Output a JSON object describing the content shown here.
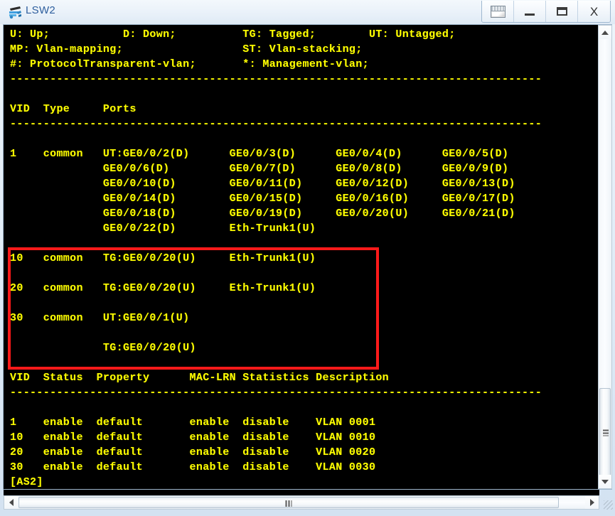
{
  "window": {
    "title": "LSW2",
    "app_icon": "switch-device-icon",
    "buttons": [
      {
        "name": "restore-layout-button",
        "glyph": "restore",
        "label": ""
      },
      {
        "name": "minimize-button",
        "glyph": "minimize",
        "label": ""
      },
      {
        "name": "maximize-button",
        "glyph": "maximize",
        "label": ""
      },
      {
        "name": "close-button",
        "glyph": "close",
        "label": "X"
      }
    ]
  },
  "colors": {
    "terminal_bg": "#000000",
    "terminal_fg": "#ffff00",
    "highlight_box": "#ff1a1a",
    "title_text": "#2f5f9e"
  },
  "terminal": {
    "legend": [
      "U: Up;           D: Down;          TG: Tagged;        UT: Untagged;",
      "MP: Vlan-mapping;                  ST: Vlan-stacking;",
      "#: ProtocolTransparent-vlan;       *: Management-vlan;"
    ],
    "separator1": "--------------------------------------------------------------------------------",
    "ports_header": "VID  Type     Ports",
    "separator2": "--------------------------------------------------------------------------------",
    "ports_rows": [
      "1    common   UT:GE0/0/2(D)      GE0/0/3(D)      GE0/0/4(D)      GE0/0/5(D)",
      "              GE0/0/6(D)         GE0/0/7(D)      GE0/0/8(D)      GE0/0/9(D)",
      "              GE0/0/10(D)        GE0/0/11(D)     GE0/0/12(D)     GE0/0/13(D)",
      "              GE0/0/14(D)        GE0/0/15(D)     GE0/0/16(D)     GE0/0/17(D)",
      "              GE0/0/18(D)        GE0/0/19(D)     GE0/0/20(U)     GE0/0/21(D)",
      "              GE0/0/22(D)        Eth-Trunk1(U)"
    ],
    "highlighted_rows": [
      "10   common   TG:GE0/0/20(U)     Eth-Trunk1(U)",
      "",
      "20   common   TG:GE0/0/20(U)     Eth-Trunk1(U)",
      "",
      "30   common   UT:GE0/0/1(U)",
      "",
      "              TG:GE0/0/20(U)"
    ],
    "status_header": "VID  Status  Property      MAC-LRN Statistics Description",
    "separator3": "--------------------------------------------------------------------------------",
    "status_rows": [
      "1    enable  default       enable  disable    VLAN 0001",
      "10   enable  default       enable  disable    VLAN 0010",
      "20   enable  default       enable  disable    VLAN 0020",
      "30   enable  default       enable  disable    VLAN 0030"
    ],
    "prompt": "[AS2]"
  },
  "scrollbars": {
    "vertical": {
      "up_arrow": "▲",
      "down_arrow": "▼"
    },
    "horizontal": {
      "left_arrow": "◀",
      "right_arrow": "▶"
    }
  }
}
